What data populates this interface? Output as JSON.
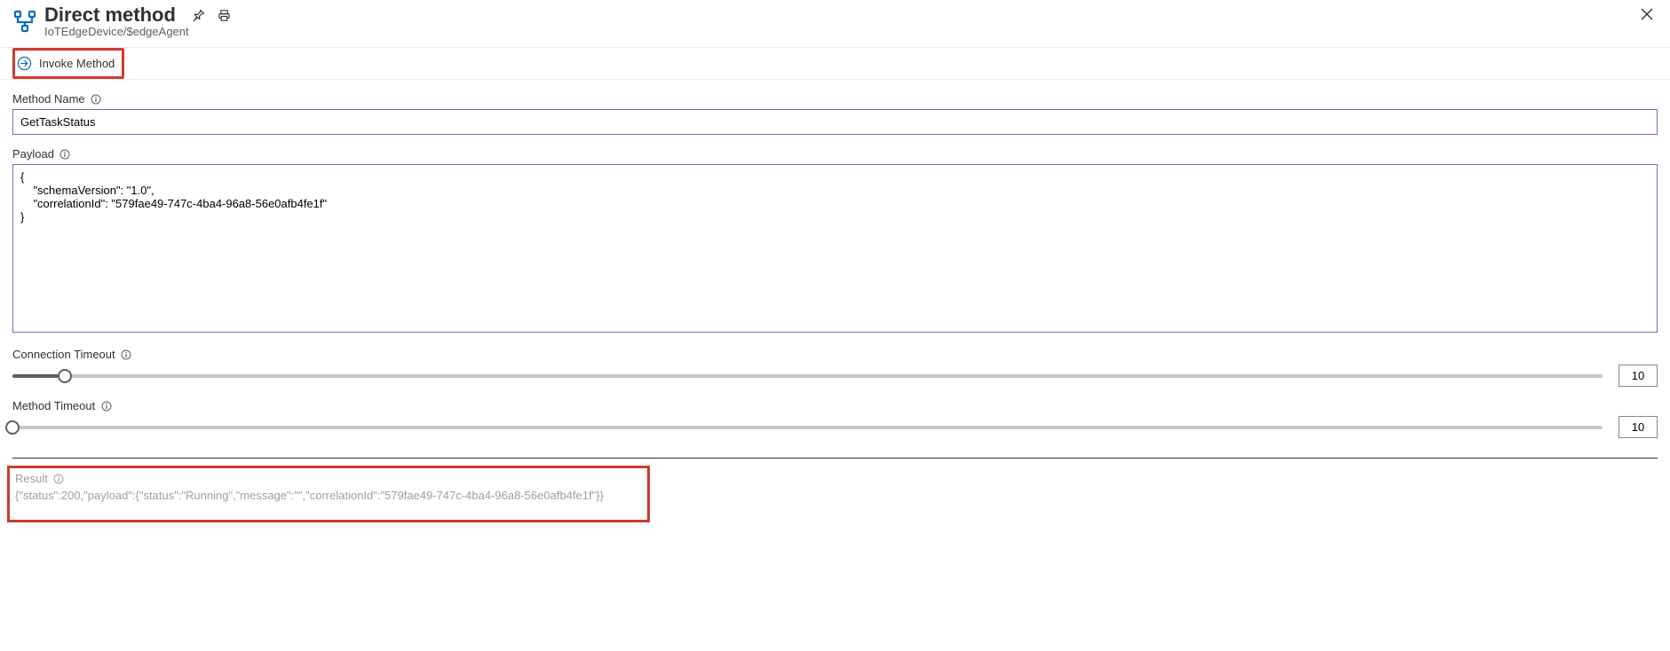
{
  "header": {
    "title": "Direct method",
    "breadcrumb": "IoTEdgeDevice/$edgeAgent"
  },
  "toolbar": {
    "invoke_label": "Invoke Method"
  },
  "fields": {
    "method_name": {
      "label": "Method Name",
      "value": "GetTaskStatus"
    },
    "payload": {
      "label": "Payload",
      "value": "{\n    \"schemaVersion\": \"1.0\",\n    \"correlationId\": \"579fae49-747c-4ba4-96a8-56e0afb4fe1f\"\n}"
    },
    "connection_timeout": {
      "label": "Connection Timeout",
      "value": "10",
      "percent": 3.3
    },
    "method_timeout": {
      "label": "Method Timeout",
      "value": "10",
      "percent": 0
    }
  },
  "result": {
    "label": "Result",
    "value": "{\"status\":200,\"payload\":{\"status\":\"Running\",\"message\":\"\",\"correlationId\":\"579fae49-747c-4ba4-96a8-56e0afb4fe1f\"}}"
  }
}
